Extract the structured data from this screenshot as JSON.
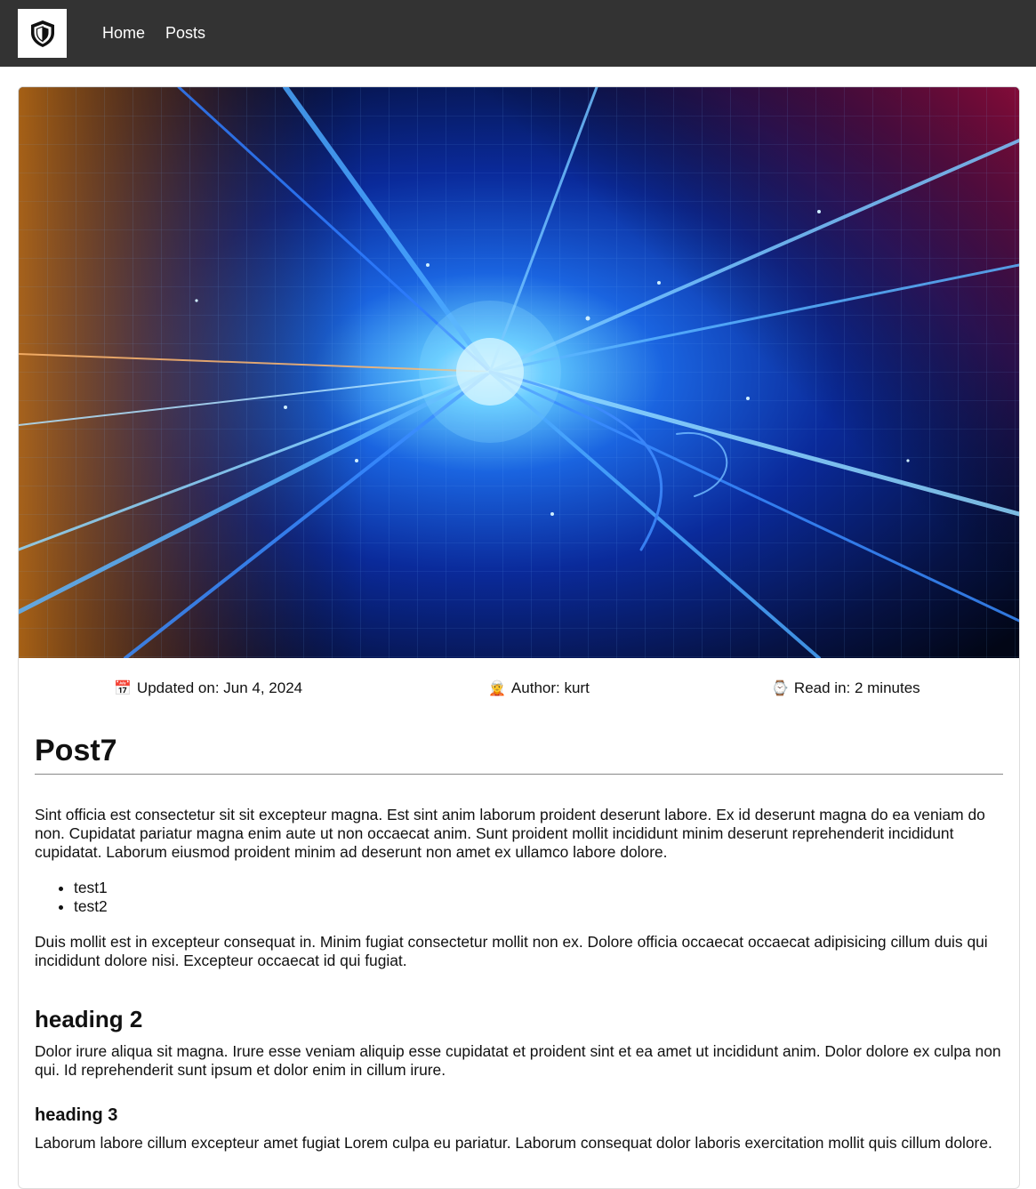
{
  "nav": {
    "logo_icon": "shield-icon",
    "links": [
      "Home",
      "Posts"
    ]
  },
  "hero": {
    "description_icon": "abstract-blue-light-streaks-image"
  },
  "meta": {
    "updated_icon": "📅",
    "updated": "Updated on: Jun 4, 2024",
    "author_icon": "🧝",
    "author": "Author: kurt",
    "read_icon": "⌚",
    "read": "Read in: 2 minutes"
  },
  "post": {
    "title": "Post7",
    "paragraph1": "Sint officia est consectetur sit sit excepteur magna. Est sint anim laborum proident deserunt labore. Ex id deserunt magna do ea veniam do non. Cupidatat pariatur magna enim aute ut non occaecat anim. Sunt proident mollit incididunt minim deserunt reprehenderit incididunt cupidatat. Laborum eiusmod proident minim ad deserunt non amet ex ullamco labore dolore.",
    "list": [
      "test1",
      "test2"
    ],
    "paragraph2": "Duis mollit est in excepteur consequat in. Minim fugiat consectetur mollit non ex. Dolore officia occaecat occaecat adipisicing cillum duis qui incididunt dolore nisi. Excepteur occaecat id qui fugiat.",
    "heading2": "heading 2",
    "paragraph3": "Dolor irure aliqua sit magna. Irure esse veniam aliquip esse cupidatat et proident sint et ea amet ut incididunt anim. Dolor dolore ex culpa non qui. Id reprehenderit sunt ipsum et dolor enim in cillum irure.",
    "heading3": "heading 3",
    "paragraph4": "Laborum labore cillum excepteur amet fugiat Lorem culpa eu pariatur. Laborum consequat dolor laboris exercitation mollit quis cillum dolore."
  },
  "colors": {
    "navbar": "#333333",
    "text": "#111111"
  }
}
